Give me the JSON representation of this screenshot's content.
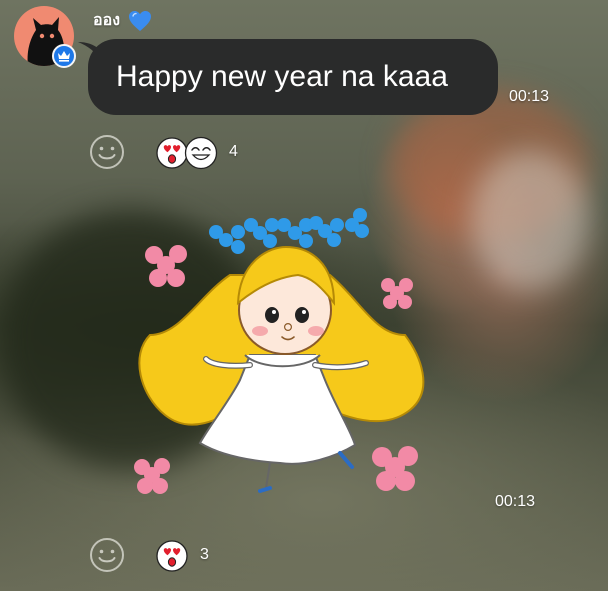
{
  "message1": {
    "sender_name": "ออง",
    "heart_icon": "blue-heart-icon",
    "text": "Happy new year na kaaa",
    "time": "00:13",
    "reaction_count": "4"
  },
  "message2": {
    "sticker": "long-blonde-hair-girl-dancing-sticker",
    "time": "00:13",
    "reaction_count": "3"
  },
  "colors": {
    "bubble": "#2a2b2b",
    "badge": "#1e78e8",
    "avatar_bg": "#f08a71"
  }
}
